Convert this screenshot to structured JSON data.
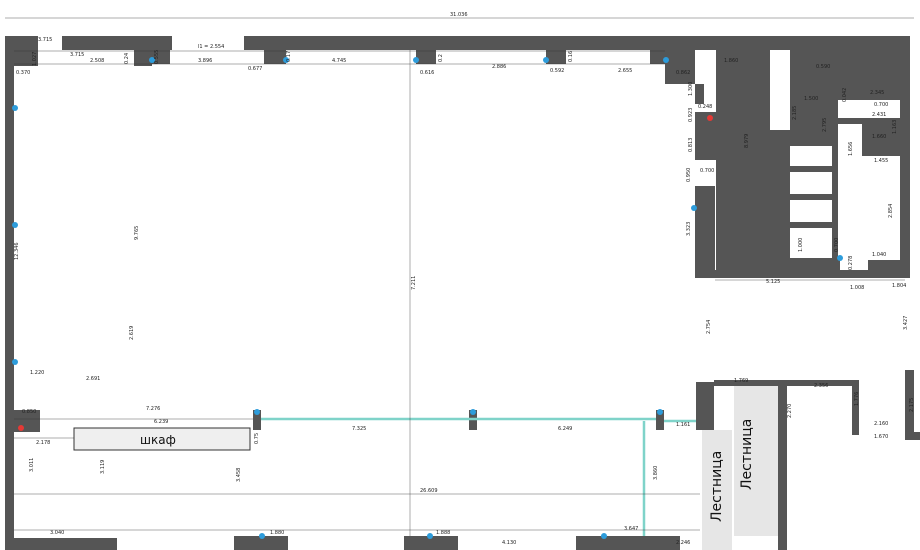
{
  "colors": {
    "wall": "#555555",
    "fixture": "#2d9cdb",
    "marker_red": "#e53935",
    "partition": "#7fd3c9",
    "stair_fill": "#e6e6e6",
    "dim_line": "#333333"
  },
  "labels": {
    "wardrobe": "шкаф",
    "stairs_1": "Лестница",
    "stairs_2": "Лестница"
  },
  "dimensions": {
    "overall_top": "31.036",
    "top_left_short": "3.715",
    "top_left_v": "1.027",
    "seg1": "3.715",
    "seg2": "2.508",
    "seg3": "0.24",
    "seg4": "0.555",
    "seg5": "3.896",
    "seg6": "l1 = 2.554",
    "seg7": "0.677",
    "seg8": "0.17",
    "seg9": "4.745",
    "seg10": "0.616",
    "seg11": "0.2",
    "seg12": "2.886",
    "seg13": "0.592",
    "seg14": "0.16",
    "seg15": "2.655",
    "seg16": "0.862",
    "left_top": "0.370",
    "room_h1": "9.765",
    "room_w_mid": "2.619",
    "left_wall": "12.346",
    "left_mid": "1.220",
    "mid_2": "2.691",
    "center_vertical": "7.211",
    "shelf_left": "0.850",
    "shelf_w": "7.276",
    "shelf_inner": "6.239",
    "left_low": "2.178",
    "left_low_v": "3.011",
    "shelf_drop": "3.119",
    "shelf_v": "0.75",
    "col_drop": "3.458",
    "partition_a": "7.325",
    "partition_b": "6.249",
    "partition_c": "1.161",
    "partition_v": "3.860",
    "bottom_overall": "26.609",
    "bottom_1": "3.040",
    "bottom_2": "1.880",
    "bottom_3": "1.888",
    "bottom_4": "4.130",
    "bottom_5": "3.647",
    "bottom_6": "2.246",
    "core_top": "1.860",
    "core_v": "8.979",
    "core_1": "1.300",
    "core_2": "0.248",
    "core_3": "0.923",
    "core_4": "0.813",
    "core_5": "0.700",
    "core_6": "0.950",
    "core_7": "3.323",
    "wc_1": "0.590",
    "wc_2": "1.500",
    "wc_3": "0.042",
    "wc_4": "2.345",
    "wc_5": "0.700",
    "wc_6": "2.431",
    "wc_7": "1.163",
    "wc_8": "2.185",
    "wc_9": "2.795",
    "wc_10": "1.660",
    "wc_11": "1.656",
    "wc_12": "1.455",
    "wc_13": "2.854",
    "wc_14": "1.000",
    "wc_15": "0.700",
    "wc_16": "0.278",
    "wc_17": "1.040",
    "lower_1": "5.125",
    "lower_2": "1.008",
    "lower_3": "1.804",
    "right_v": "3.427",
    "stair_v": "2.754",
    "stair_w": "1.769",
    "stair_room": "2.356",
    "stair_v2": "2.270",
    "stair_v3": "1.776",
    "right_low": "2.160",
    "right_low2": "1.670",
    "right_low_v": "2.175"
  }
}
